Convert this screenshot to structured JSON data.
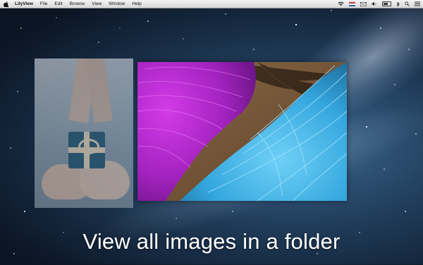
{
  "menubar": {
    "app_name": "LilyView",
    "items": [
      "File",
      "Edit",
      "Browse",
      "View",
      "Window",
      "Help"
    ]
  },
  "tray_icons": [
    "wifi-icon",
    "flag-icon",
    "mail-icon",
    "volume-icon",
    "battery-icon",
    "bluetooth-icon",
    "search-icon",
    "list-icon"
  ],
  "thumbnail": {
    "subject": "hands holding gift box"
  },
  "photo": {
    "subject": "magenta and blue feathers"
  },
  "caption": "View all images in a folder",
  "colors": {
    "magenta": "#b52ad0",
    "cyan": "#39b4e8",
    "background": "#1d3550"
  }
}
